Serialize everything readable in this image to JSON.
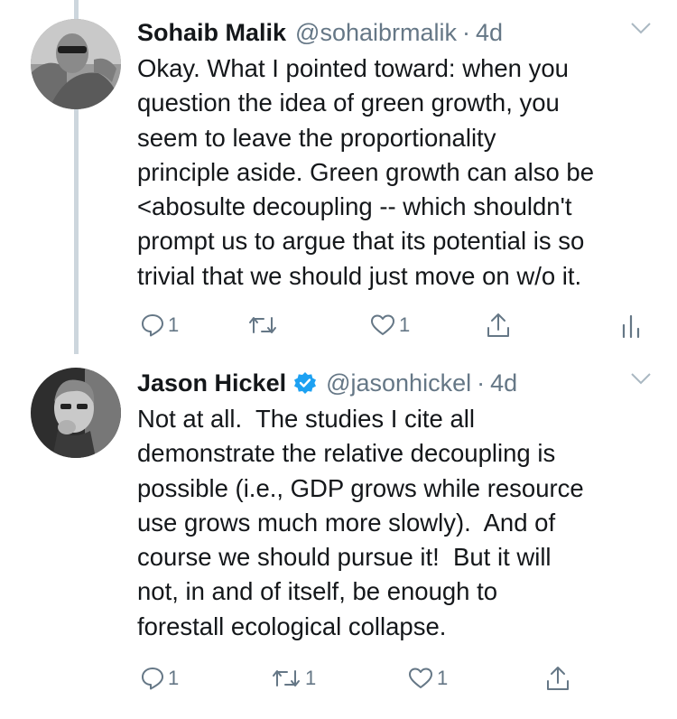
{
  "tweets": [
    {
      "author_name": "Sohaib Malik",
      "handle": "@sohaibrmalik",
      "separator": "·",
      "time": "4d",
      "verified": false,
      "text": "Okay. What I pointed toward: when you\nquestion the idea of green growth, you\nseem to leave the proportionality\nprinciple aside. Green growth can also be\n<abosulte decoupling -- which shouldn't\nprompt us to argue that its potential is so\ntrivial that we should just move on w/o it.",
      "reply_count": "1",
      "retweet_count": "",
      "like_count": "1",
      "has_analytics": true
    },
    {
      "author_name": "Jason Hickel",
      "handle": "@jasonhickel",
      "separator": "·",
      "time": "4d",
      "verified": true,
      "text": "Not at all.  The studies I cite all\ndemonstrate the relative decoupling is\npossible (i.e., GDP grows while resource\nuse grows much more slowly).  And of\ncourse we should pursue it!  But it will\nnot, in and of itself, be enough to\nforestall ecological collapse.",
      "reply_count": "1",
      "retweet_count": "1",
      "like_count": "1",
      "has_analytics": false
    }
  ],
  "icons": {
    "reply": "reply-icon",
    "retweet": "retweet-icon",
    "like": "heart-icon",
    "share": "share-icon",
    "analytics": "analytics-icon",
    "caret": "chevron-down-icon",
    "verified": "verified-badge-icon"
  },
  "colors": {
    "text": "#14171a",
    "secondary": "#657786",
    "thread_line": "#cdd6dd",
    "verified": "#1da1f2"
  }
}
